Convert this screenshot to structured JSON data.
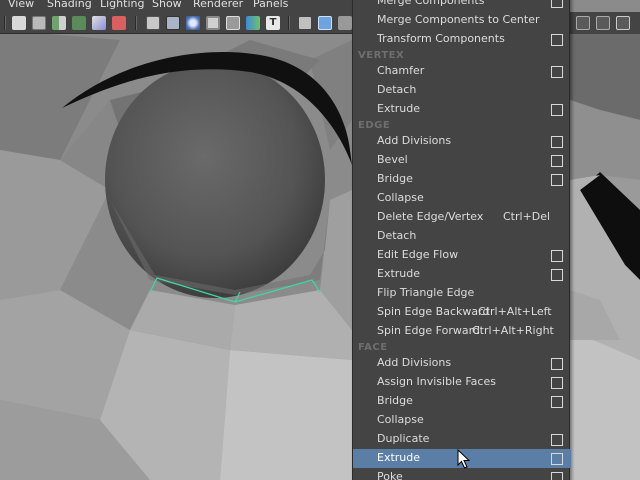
{
  "menubar": [
    "View",
    "Shading",
    "Lighting",
    "Show",
    "Renderer",
    "Panels"
  ],
  "colors": {
    "menu_bg": "#444444",
    "highlight": "#5b7ea6",
    "section_header": "#6e6e6e",
    "edge_select": "#3dd8a6"
  },
  "menu": {
    "items_top": [
      {
        "label": "Merge Components",
        "option_box": true
      },
      {
        "label": "Merge Components to Center",
        "option_box": false
      },
      {
        "label": "Transform Components",
        "option_box": true
      }
    ],
    "vertex_header": "VERTEX",
    "vertex_items": [
      {
        "label": "Chamfer",
        "option_box": true
      },
      {
        "label": "Detach",
        "option_box": false
      },
      {
        "label": "Extrude",
        "option_box": true
      }
    ],
    "edge_header": "EDGE",
    "edge_items": [
      {
        "label": "Add Divisions",
        "option_box": true
      },
      {
        "label": "Bevel",
        "option_box": true
      },
      {
        "label": "Bridge",
        "option_box": true
      },
      {
        "label": "Collapse",
        "option_box": false
      },
      {
        "label": "Delete Edge/Vertex",
        "shortcut": "Ctrl+Del",
        "option_box": false
      },
      {
        "label": "Detach",
        "option_box": false
      },
      {
        "label": "Edit Edge Flow",
        "option_box": true
      },
      {
        "label": "Extrude",
        "option_box": true
      },
      {
        "label": "Flip Triangle Edge",
        "option_box": false
      },
      {
        "label": "Spin Edge Backward",
        "shortcut": "Ctrl+Alt+Left",
        "option_box": false
      },
      {
        "label": "Spin Edge Forward",
        "shortcut": "Ctrl+Alt+Right",
        "option_box": false
      }
    ],
    "face_header": "FACE",
    "face_items": [
      {
        "label": "Add Divisions",
        "option_box": true
      },
      {
        "label": "Assign Invisible Faces",
        "option_box": true
      },
      {
        "label": "Bridge",
        "option_box": true
      },
      {
        "label": "Collapse",
        "option_box": false
      },
      {
        "label": "Duplicate",
        "option_box": true
      },
      {
        "label": "Extrude",
        "option_box": true,
        "selected": true
      },
      {
        "label": "Poke",
        "option_box": true
      }
    ]
  }
}
